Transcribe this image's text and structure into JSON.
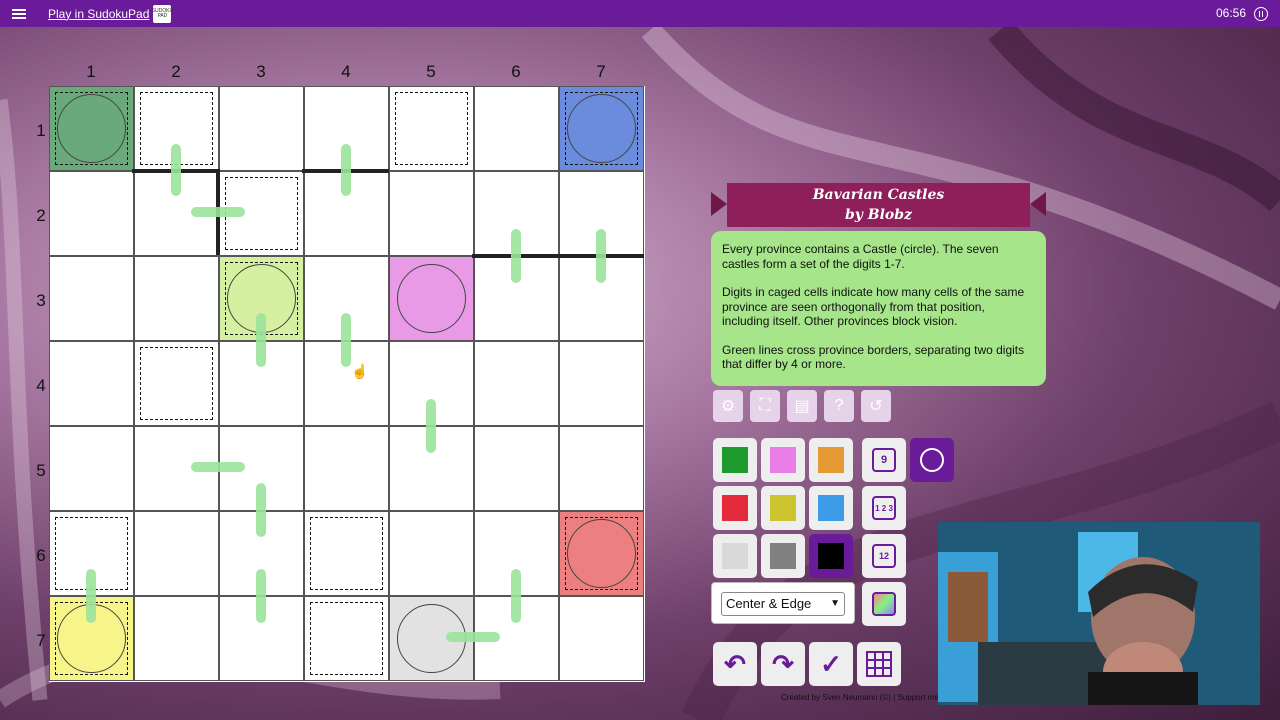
{
  "topbar": {
    "link_label": "Play in SudokuPad",
    "time": "06:56"
  },
  "board": {
    "columns": [
      "1",
      "2",
      "3",
      "4",
      "5",
      "6",
      "7"
    ],
    "rows": [
      "1",
      "2",
      "3",
      "4",
      "5",
      "6",
      "7"
    ],
    "colors": {
      "green": "#6aaa7a",
      "blue": "#6b8bdc",
      "lime": "#d5f0a0",
      "pink": "#e99ae6",
      "red": "#ec8080",
      "yellow": "#f7f48a",
      "gray": "#e2e2e2",
      "green_line": "#9be29b"
    }
  },
  "puzzle": {
    "title_line1": "Bavarian Castles",
    "title_line2": "by Blobz",
    "rules": [
      "Every province contains a Castle (circle). The seven castles form a set of the digits 1-7.",
      "Digits in caged cells indicate how many cells of the same province are seen orthogonally from that position, including itself. Other provinces block vision.",
      "Green lines cross province borders, separating two digits that differ by 4 or more."
    ]
  },
  "tools": [
    "gear-icon",
    "fullscreen-icon",
    "clipboard-icon",
    "help-icon",
    "restart-icon"
  ],
  "palette": {
    "colors": [
      "#1f9a2f",
      "#ea7ee7",
      "#e69a35",
      "#e32b3b",
      "#ccc530",
      "#3e9be8",
      "#d9d9d9",
      "#808080",
      "#000000"
    ]
  },
  "modes": {
    "normal": "9",
    "corner": "1 2 3",
    "center": "12"
  },
  "select": {
    "value": "Center & Edge"
  },
  "credit": "Created by Sven Neumann (©) | Support me o"
}
